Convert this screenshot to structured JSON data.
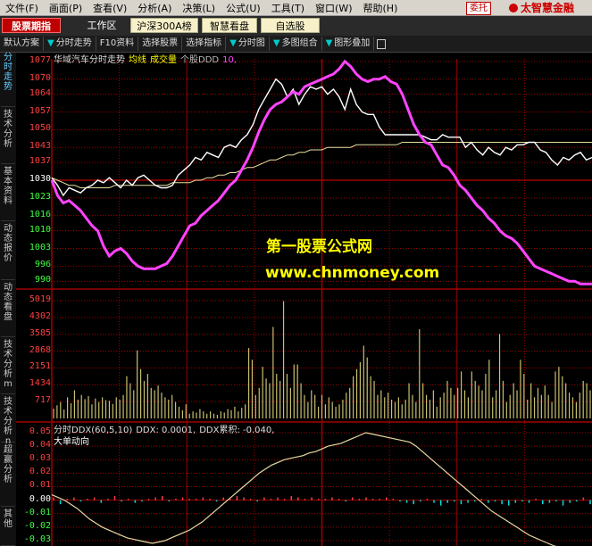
{
  "menubar": {
    "items": [
      "文件(F)",
      "画面(P)",
      "查看(V)",
      "分析(A)",
      "决策(L)",
      "公式(U)",
      "工具(T)",
      "窗口(W)",
      "帮助(H)"
    ],
    "tag": "委托",
    "brand": "太智慧金融"
  },
  "toolbar": {
    "stock_label": "股票期指",
    "workspace_label": "工作区",
    "hs300_label": "沪深300A榜",
    "watch_label": "智慧看盘",
    "self_label": "自选股"
  },
  "subtoolbar": {
    "items": [
      "默认方案",
      "分时走势",
      "F10资料",
      "选择股票",
      "选择指标",
      "分时图",
      "多图组合",
      "图形叠加"
    ],
    "arrow_items": [
      1,
      5,
      6,
      7
    ]
  },
  "sidetabs": [
    "分时走势",
    "技术分析",
    "基本资料",
    "动态报价",
    "动态看盘",
    "技术分析m",
    "技术分析n",
    "超赢分析",
    "其他"
  ],
  "price_panel": {
    "header_parts": [
      {
        "text": "华域汽车分时走势",
        "color": "#dddddd"
      },
      {
        "text": "均线",
        "color": "#ffff00"
      },
      {
        "text": "成交量",
        "color": "#ffff00"
      },
      {
        "text": "个股DDD",
        "color": "#bbbbbb"
      },
      {
        "text": "10,",
        "color": "#ff44ff"
      }
    ],
    "y_labels": [
      {
        "text": "1077",
        "color": "#ff4040",
        "value": 1077
      },
      {
        "text": "1070",
        "color": "#ff4040",
        "value": 1070
      },
      {
        "text": "1064",
        "color": "#ff4040",
        "value": 1064
      },
      {
        "text": "1057",
        "color": "#ff4040",
        "value": 1057
      },
      {
        "text": "1050",
        "color": "#ff4040",
        "value": 1050
      },
      {
        "text": "1043",
        "color": "#ff4040",
        "value": 1043
      },
      {
        "text": "1037",
        "color": "#ff4040",
        "value": 1037
      },
      {
        "text": "1030",
        "color": "#ffffff",
        "value": 1030
      },
      {
        "text": "1023",
        "color": "#40ff40",
        "value": 1023
      },
      {
        "text": "1016",
        "color": "#40ff40",
        "value": 1016
      },
      {
        "text": "1010",
        "color": "#40ff40",
        "value": 1010
      },
      {
        "text": "1003",
        "color": "#40ff40",
        "value": 1003
      },
      {
        "text": "996",
        "color": "#40ff40",
        "value": 996
      },
      {
        "text": "990",
        "color": "#40ff40",
        "value": 990
      }
    ],
    "ylim": [
      988,
      1078
    ],
    "price_line": [
      1031,
      1028,
      1024,
      1027,
      1026,
      1025,
      1027,
      1028,
      1030,
      1029,
      1031,
      1029,
      1027,
      1030,
      1028,
      1031,
      1032,
      1030,
      1028,
      1027,
      1027,
      1028,
      1032,
      1034,
      1036,
      1039,
      1038,
      1041,
      1040,
      1039,
      1043,
      1044,
      1043,
      1046,
      1048,
      1052,
      1058,
      1062,
      1066,
      1070,
      1068,
      1063,
      1066,
      1060,
      1064,
      1067,
      1066,
      1067,
      1064,
      1066,
      1063,
      1058,
      1066,
      1060,
      1057,
      1056,
      1056,
      1051,
      1048,
      1048,
      1048,
      1048,
      1048,
      1048,
      1048,
      1047,
      1046,
      1046,
      1048,
      1047,
      1047,
      1047,
      1043,
      1045,
      1042,
      1040,
      1043,
      1041,
      1040,
      1043,
      1042,
      1044,
      1044,
      1045,
      1045,
      1042,
      1041,
      1038,
      1036,
      1039,
      1038,
      1040,
      1041,
      1038,
      1039
    ],
    "avg_line": [
      1031,
      1030,
      1029,
      1028,
      1028,
      1027,
      1027,
      1027,
      1027,
      1027,
      1027,
      1028,
      1028,
      1028,
      1028,
      1028,
      1028,
      1028,
      1028,
      1028,
      1028,
      1029,
      1029,
      1029,
      1029,
      1030,
      1030,
      1031,
      1031,
      1032,
      1032,
      1033,
      1033,
      1034,
      1035,
      1035,
      1036,
      1037,
      1038,
      1038,
      1039,
      1040,
      1040,
      1041,
      1041,
      1042,
      1042,
      1042,
      1043,
      1043,
      1043,
      1043,
      1043,
      1044,
      1044,
      1044,
      1044,
      1044,
      1044,
      1044,
      1044,
      1045,
      1045,
      1045,
      1045,
      1045,
      1045,
      1045,
      1045,
      1045,
      1045,
      1045,
      1045,
      1045,
      1045,
      1045,
      1045,
      1045,
      1045,
      1045,
      1045,
      1045,
      1045,
      1045,
      1045,
      1045,
      1045,
      1045,
      1045,
      1045,
      1045,
      1045,
      1045,
      1045,
      1045
    ],
    "ddd_line": [
      1030,
      1024,
      1021,
      1022,
      1020,
      1018,
      1015,
      1012,
      1010,
      1004,
      1000,
      1002,
      1003,
      1001,
      998,
      996,
      995,
      995,
      995,
      996,
      997,
      1000,
      1004,
      1008,
      1012,
      1013,
      1016,
      1018,
      1020,
      1022,
      1025,
      1028,
      1030,
      1034,
      1038,
      1043,
      1049,
      1054,
      1058,
      1060,
      1061,
      1063,
      1065,
      1064,
      1067,
      1068,
      1069,
      1070,
      1071,
      1072,
      1074,
      1077,
      1075,
      1072,
      1070,
      1069,
      1070,
      1070,
      1071,
      1069,
      1068,
      1064,
      1058,
      1052,
      1048,
      1045,
      1044,
      1040,
      1036,
      1035,
      1032,
      1028,
      1026,
      1023,
      1020,
      1018,
      1015,
      1013,
      1010,
      1008,
      1007,
      1005,
      1002,
      999,
      996,
      995,
      994,
      993,
      992,
      991,
      990,
      990,
      989,
      989,
      989
    ],
    "ddd_color": "#ff44ff"
  },
  "volume_panel": {
    "y_labels": [
      "5019",
      "4302",
      "3585",
      "2868",
      "2151",
      "1434",
      "717"
    ],
    "ylim": [
      0,
      5400
    ],
    "values": [
      420,
      560,
      700,
      380,
      900,
      650,
      1200,
      800,
      1000,
      820,
      950,
      600,
      850,
      700,
      900,
      780,
      750,
      620,
      900,
      800,
      1000,
      1800,
      1500,
      1200,
      2900,
      2100,
      1600,
      1900,
      1300,
      1200,
      1400,
      1100,
      900,
      800,
      1000,
      700,
      500,
      350,
      600,
      200,
      300,
      250,
      400,
      300,
      200,
      300,
      200,
      150,
      300,
      250,
      400,
      350,
      500,
      300,
      450,
      600,
      3000,
      2500,
      1000,
      1300,
      2200,
      1700,
      1500,
      3900,
      1900,
      1600,
      5000,
      1900,
      1300,
      2300,
      2300,
      1500,
      1000,
      700,
      1200,
      1000,
      500,
      1000,
      600,
      900,
      700,
      500,
      600,
      800,
      1100,
      1300,
      1800,
      2100,
      2400,
      3100,
      2600,
      1800,
      1600,
      1000,
      1200,
      900,
      1100,
      800,
      700,
      900,
      600,
      800,
      1500,
      1000,
      700,
      3800,
      1500,
      1000,
      800,
      1200,
      500,
      900,
      1100,
      1600,
      1300,
      1000,
      1300,
      2000,
      1200,
      900,
      2000,
      1600,
      1400,
      1200,
      1900,
      2500,
      900,
      1200,
      3600,
      1600,
      700,
      1000,
      1500,
      1200,
      2500,
      1900,
      800,
      1500,
      900,
      1300,
      1000,
      1400,
      1000,
      700,
      2000,
      2200,
      1800,
      1500,
      1100,
      900,
      700,
      1100,
      1600,
      1500,
      1200
    ],
    "bar_color": "#c8c070"
  },
  "ddx_panel": {
    "header_parts": [
      {
        "text": "分时DDX(60,5,10)",
        "color": "#dddddd"
      },
      {
        "text": "DDX: 0.0001,",
        "color": "#dddddd"
      },
      {
        "text": "DDX累积: -0.040,",
        "color": "#dddddd"
      }
    ],
    "legend_label": "大单动向",
    "y_labels": [
      "0.05",
      "0.04",
      "0.03",
      "0.02",
      "0.01",
      "0.00",
      "-0.01",
      "-0.02",
      "-0.03"
    ],
    "ylim": [
      -0.034,
      0.052
    ],
    "cum_line": [
      0.004,
      0.002,
      0.0,
      -0.003,
      -0.006,
      -0.01,
      -0.014,
      -0.017,
      -0.02,
      -0.022,
      -0.024,
      -0.026,
      -0.028,
      -0.029,
      -0.03,
      -0.031,
      -0.032,
      -0.031,
      -0.03,
      -0.028,
      -0.026,
      -0.024,
      -0.022,
      -0.019,
      -0.016,
      -0.012,
      -0.008,
      -0.004,
      0.0,
      0.004,
      0.008,
      0.012,
      0.016,
      0.02,
      0.023,
      0.026,
      0.028,
      0.03,
      0.031,
      0.032,
      0.033,
      0.035,
      0.036,
      0.038,
      0.04,
      0.041,
      0.042,
      0.044,
      0.046,
      0.048,
      0.05,
      0.049,
      0.048,
      0.047,
      0.046,
      0.045,
      0.044,
      0.043,
      0.04,
      0.036,
      0.032,
      0.028,
      0.024,
      0.02,
      0.016,
      0.012,
      0.008,
      0.004,
      0.0,
      -0.004,
      -0.008,
      -0.011,
      -0.014,
      -0.017,
      -0.02,
      -0.023,
      -0.026,
      -0.028,
      -0.03,
      -0.032,
      -0.034,
      -0.035,
      -0.036,
      -0.037,
      -0.038,
      -0.039,
      -0.04
    ],
    "cum_color": "#e8d8a0",
    "ddx_bars": [
      0.002,
      -0.003,
      0.001,
      0.002,
      -0.001,
      0.001,
      0.002,
      -0.002,
      0.001,
      0.003,
      -0.001,
      0.001,
      -0.002,
      -0.001,
      0.001,
      0.002,
      0.003,
      -0.001,
      0.001,
      0.002,
      0.001,
      0.001,
      0.002,
      0.001,
      -0.001,
      0.002,
      0.001,
      0.003,
      0.002,
      0.001,
      -0.001,
      0.002,
      0.001,
      0.002,
      0.001,
      0.003,
      0.002,
      0.001,
      0.002,
      0.001,
      0.001,
      0.002,
      0.001,
      -0.001,
      0.002,
      0.001,
      0.002,
      0.001,
      0.001,
      0.002,
      0.001,
      -0.001,
      -0.002,
      -0.003,
      -0.001,
      0.001,
      -0.002,
      -0.004,
      -0.002,
      -0.001,
      -0.003,
      -0.002,
      -0.001,
      0.001,
      -0.002,
      -0.001,
      -0.003,
      -0.004,
      -0.002,
      -0.001,
      -0.002,
      0.001,
      -0.003,
      -0.002,
      -0.001,
      -0.004,
      -0.002,
      -0.001,
      0.002,
      -0.003
    ],
    "pos_color": "#ff4040",
    "neg_color": "#00e0e0"
  },
  "watermark": {
    "line1": "第一股票公式网",
    "line2": "www.chnmoney.com"
  },
  "colors": {
    "grid": "#a00000",
    "price_line": "#ffffff",
    "avg_line": "#e8e0a0"
  }
}
